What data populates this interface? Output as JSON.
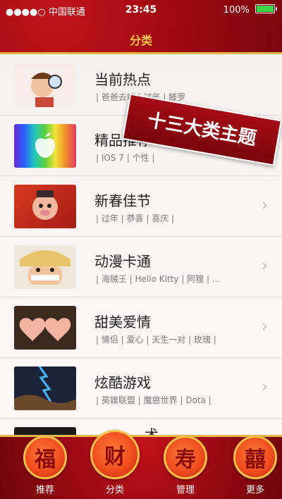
{
  "status": {
    "carrier": "●●●●○ 中国联通",
    "time": "23:45",
    "battery": "100%",
    "battery_level": 1.0
  },
  "nav": {
    "title": "分类"
  },
  "banner": {
    "text": "十三大类主题"
  },
  "rows": [
    {
      "title": "当前热点",
      "tags": "| 爸爸去哪 | 过年 | 滕罗",
      "icon": "magnifier-boy-thumb",
      "color": "#f6e9e3"
    },
    {
      "title": "精品推荐",
      "tags": "| IOS 7 | 个性 |",
      "icon": "rainbow-apple-thumb",
      "color": "#3b2a74"
    },
    {
      "title": "新春佳节",
      "tags": "| 过年 | 恭喜 | 喜庆 |",
      "icon": "new-year-pig-thumb",
      "color": "#c92a1a"
    },
    {
      "title": "动漫卡通",
      "tags": "| 海贼王 | Hello Kitty | 阿狸 | ...",
      "icon": "anime-face-thumb",
      "color": "#f1efe8"
    },
    {
      "title": "甜美爱情",
      "tags": "| 情侣 | 爱心 | 天生一对 | 玫瑰 |",
      "icon": "heart-peaches-thumb",
      "color": "#3c2a20"
    },
    {
      "title": "炫酷游戏",
      "tags": "| 英雄联盟 | 魔兽世界 | Dota |",
      "icon": "lightning-game-thumb",
      "color": "#2b3b5a"
    },
    {
      "title": "术",
      "tags": "",
      "icon": "art-thumb",
      "color": "#1b1b1b"
    }
  ],
  "tabs": [
    {
      "label": "推荐",
      "glyph": "福",
      "active": false
    },
    {
      "label": "分类",
      "glyph": "财",
      "active": true
    },
    {
      "label": "管理",
      "glyph": "寿",
      "active": false
    },
    {
      "label": "更多",
      "glyph": "囍",
      "active": false
    }
  ]
}
